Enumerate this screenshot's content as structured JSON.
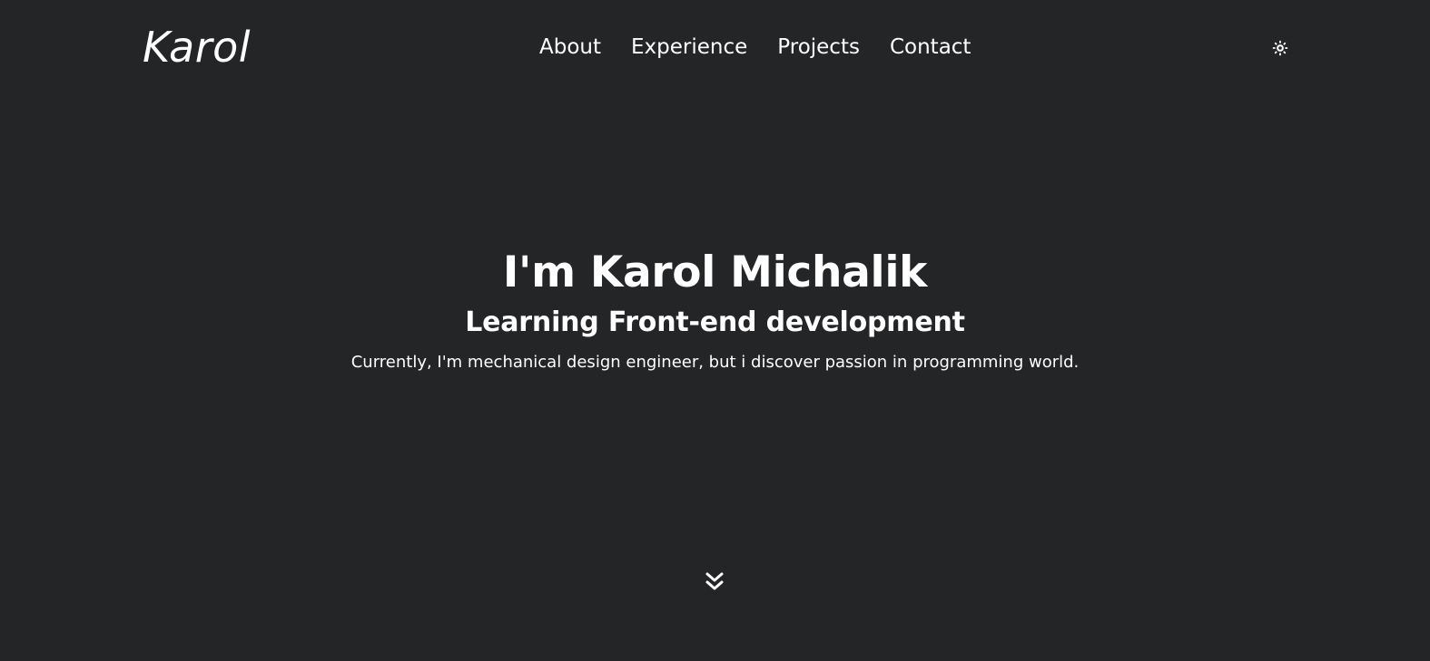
{
  "header": {
    "logo_text": "Karol",
    "nav": {
      "about": "About",
      "experience": "Experience",
      "projects": "Projects",
      "contact": "Contact"
    },
    "theme_toggle_icon": "sun-icon"
  },
  "hero": {
    "title": "I'm Karol Michalik",
    "subtitle": "Learning Front-end development",
    "description": "Currently, I'm mechanical design engineer, but i discover passion in programming world."
  },
  "scroll_icon": "double-chevron-down-icon",
  "colors": {
    "background": "#232527",
    "text": "#ffffff"
  }
}
